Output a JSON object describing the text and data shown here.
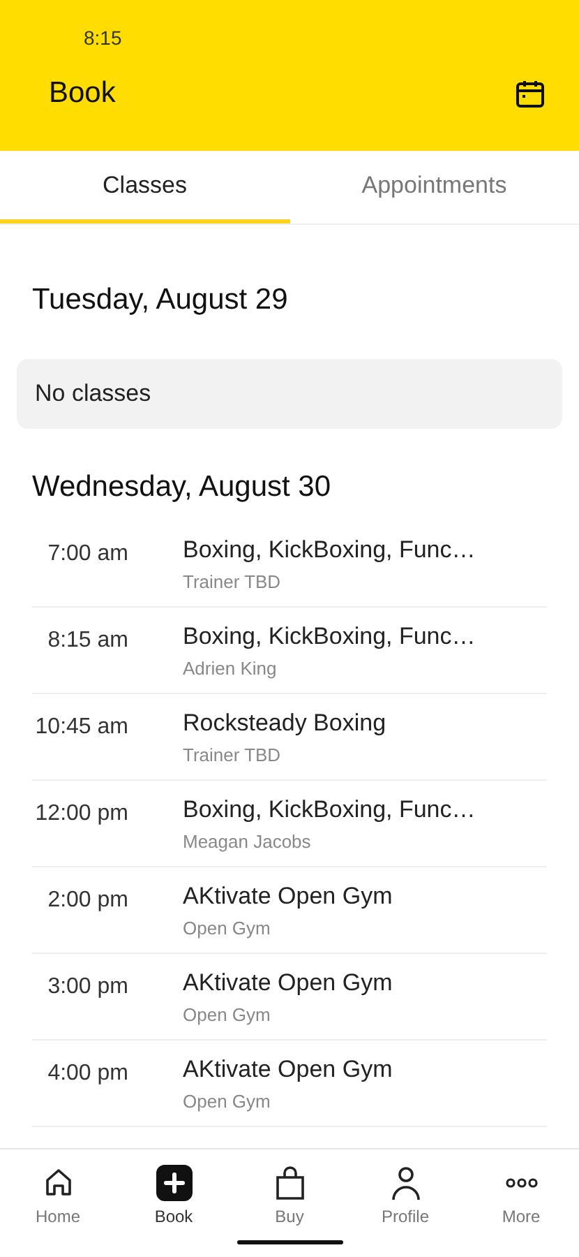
{
  "status_bar": {
    "time": "8:15"
  },
  "header": {
    "title": "Book"
  },
  "tabs": [
    {
      "label": "Classes",
      "selected": true
    },
    {
      "label": "Appointments",
      "selected": false
    }
  ],
  "days": [
    {
      "date": "Tuesday, August 29",
      "empty_message": "No classes"
    },
    {
      "date": "Wednesday, August 30",
      "classes": [
        {
          "time": "7:00 am",
          "name": "Boxing, KickBoxing, Func…",
          "instructor": "Trainer TBD"
        },
        {
          "time": "8:15 am",
          "name": "Boxing, KickBoxing, Func…",
          "instructor": "Adrien King"
        },
        {
          "time": "10:45 am",
          "name": "Rocksteady Boxing",
          "instructor": "Trainer TBD"
        },
        {
          "time": "12:00 pm",
          "name": "Boxing, KickBoxing, Func…",
          "instructor": "Meagan Jacobs"
        },
        {
          "time": "2:00 pm",
          "name": "AKtivate Open Gym",
          "instructor": "Open Gym"
        },
        {
          "time": "3:00 pm",
          "name": "AKtivate Open Gym",
          "instructor": "Open Gym"
        },
        {
          "time": "4:00 pm",
          "name": "AKtivate Open Gym",
          "instructor": "Open Gym"
        }
      ]
    }
  ],
  "bottom_nav": [
    {
      "kind": "home",
      "label": "Home",
      "selected": false
    },
    {
      "kind": "book",
      "label": "Book",
      "selected": true
    },
    {
      "kind": "buy",
      "label": "Buy",
      "selected": false
    },
    {
      "kind": "profile",
      "label": "Profile",
      "selected": false
    },
    {
      "kind": "more",
      "label": "More",
      "selected": false
    }
  ]
}
